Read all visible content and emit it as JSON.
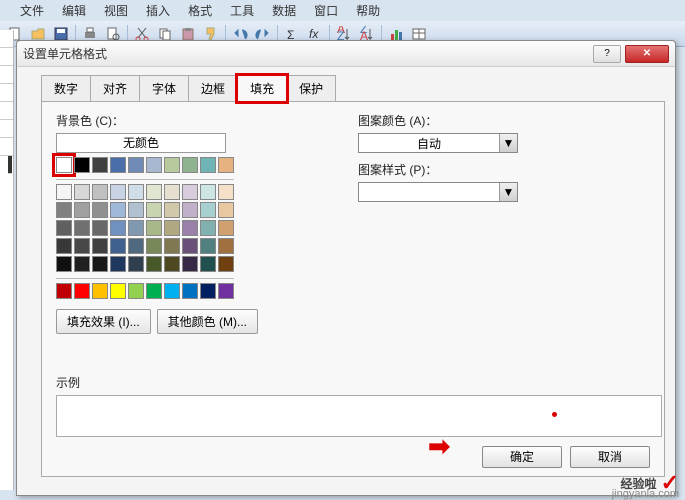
{
  "menu": {
    "items": [
      "文件",
      "编辑",
      "视图",
      "插入",
      "格式",
      "工具",
      "数据",
      "窗口",
      "帮助"
    ]
  },
  "dialog": {
    "title": "设置单元格格式",
    "tabs": [
      "数字",
      "对齐",
      "字体",
      "边框",
      "填充",
      "保护"
    ],
    "active_tab": 4,
    "bg_label": "背景色 (C)：",
    "no_color": "无颜色",
    "pattern_color_label": "图案颜色 (A)：",
    "pattern_color_value": "自动",
    "pattern_style_label": "图案样式 (P)：",
    "fill_effects_btn": "填充效果 (I)...",
    "more_colors_btn": "其他颜色 (M)...",
    "example_label": "示例",
    "ok": "确定",
    "cancel": "取消"
  },
  "palette": {
    "row1": [
      "#ffffff",
      "#000000",
      "#404040",
      "#4a6ea9",
      "#6f8bb5",
      "#a7b8d0",
      "#b8c99e",
      "#8fb28f",
      "#6fb5b5",
      "#e6b380"
    ],
    "row2": [
      "#f5f5f5",
      "#d8d8d8",
      "#c0c0c0",
      "#c8d4e6",
      "#d0dce8",
      "#e0e6d0",
      "#e6e0d0",
      "#d8ccdd",
      "#cce5e5",
      "#f5e0c8"
    ],
    "row3": [
      "#808080",
      "#a0a0a0",
      "#909090",
      "#a0b8d8",
      "#b0c0d0",
      "#c8d4b0",
      "#d0c8a8",
      "#c0b0c8",
      "#a8d0d0",
      "#e8c8a0"
    ],
    "row4": [
      "#606060",
      "#707070",
      "#686868",
      "#7090c0",
      "#8098b0",
      "#a8b888",
      "#b0a880",
      "#9880a8",
      "#80b0b0",
      "#d0a070"
    ],
    "row5": [
      "#383838",
      "#484848",
      "#404040",
      "#406090",
      "#506880",
      "#788858",
      "#807850",
      "#685078",
      "#508080",
      "#a07040"
    ],
    "row6": [
      "#101010",
      "#202020",
      "#181818",
      "#203860",
      "#304050",
      "#485828",
      "#504820",
      "#382848",
      "#205050",
      "#704010"
    ],
    "accent": [
      "#c00000",
      "#ff0000",
      "#ffc000",
      "#ffff00",
      "#92d050",
      "#00b050",
      "#00b0f0",
      "#0070c0",
      "#002060",
      "#7030a0"
    ]
  },
  "watermark": {
    "text1": "经验啦",
    "text2": "jingyanla.com"
  }
}
